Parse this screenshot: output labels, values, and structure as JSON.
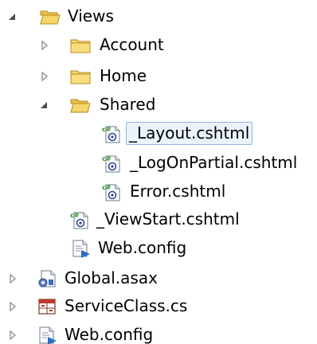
{
  "tree": {
    "views_folder": {
      "label": "Views"
    },
    "account_folder": {
      "label": "Account"
    },
    "home_folder": {
      "label": "Home"
    },
    "shared_folder": {
      "label": "Shared"
    },
    "layout_file": {
      "label": "_Layout.cshtml",
      "selected": true
    },
    "logonpartial_file": {
      "label": "_LogOnPartial.cshtml"
    },
    "error_file": {
      "label": "Error.cshtml"
    },
    "viewstart_file": {
      "label": "_ViewStart.cshtml"
    },
    "views_webconfig": {
      "label": "Web.config"
    },
    "global_asax": {
      "label": "Global.asax"
    },
    "serviceclass": {
      "label": "ServiceClass.cs"
    },
    "root_webconfig": {
      "label": "Web.config"
    }
  },
  "colors": {
    "folder_fill": "#f6d56a",
    "folder_edge": "#b58b1e",
    "selection_bg": "#eaf2fb",
    "selection_border": "#8db7e6",
    "expander": "#4d4d4d",
    "collapsed_expander": "#8c8c8c"
  },
  "icons": {
    "expanded": "triangle-expanded-icon",
    "collapsed": "triangle-collapsed-icon",
    "folder_open": "folder-open-icon",
    "folder_closed": "folder-closed-icon",
    "cshtml": "cshtml-file-icon",
    "config": "config-file-icon",
    "asax": "asax-file-icon",
    "cs": "csharp-class-file-icon"
  }
}
